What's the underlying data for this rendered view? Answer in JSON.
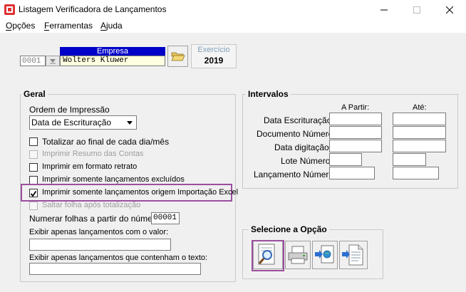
{
  "window": {
    "title": "Listagem Verificadora de Lançamentos"
  },
  "menu": [
    {
      "label": "Opções",
      "accel": "O"
    },
    {
      "label": "Ferramentas",
      "accel": "F"
    },
    {
      "label": "Ajuda",
      "accel": "A"
    }
  ],
  "empresa": {
    "label": "Empresa",
    "code": "0001",
    "name": "Wolters Kluwer"
  },
  "exercicio": {
    "label": "Exercício",
    "value": "2019"
  },
  "geral": {
    "title": "Geral",
    "ordem_label": "Ordem de Impressão",
    "ordem_value": "Data de Escrituração",
    "options": [
      {
        "label": "Totalizar ao final de cada dia/mês",
        "checked": false,
        "enabled": true
      },
      {
        "label": "Imprimir Resumo das Contas",
        "checked": false,
        "enabled": false
      },
      {
        "label": "Imprimir em formato retrato",
        "checked": false,
        "enabled": true
      },
      {
        "label": "Imprimir somente lançamentos excluídos",
        "checked": false,
        "enabled": true
      },
      {
        "label": "Imprimir somente lançamentos origem Importação Excel",
        "checked": true,
        "enabled": true
      },
      {
        "label": "Saltar folha após totalização",
        "checked": false,
        "enabled": false
      }
    ],
    "numerar_label": "Numerar folhas a partir do número",
    "numerar_value": "00001",
    "valor_label": "Exibir apenas lançamentos com o valor:",
    "valor_value": "",
    "texto_label": "Exibir apenas lançamentos que contenham o texto:",
    "texto_value": ""
  },
  "intervalos": {
    "title": "Intervalos",
    "col_from": "A Partir:",
    "col_to": "Até:",
    "rows": [
      {
        "label": "Data Escrituração",
        "from": "",
        "to": ""
      },
      {
        "label": "Documento Número",
        "from": "",
        "to": ""
      },
      {
        "label": "Data digitação",
        "from": "",
        "to": ""
      },
      {
        "label": "Lote Número",
        "from": "",
        "to": ""
      },
      {
        "label": "Lançamento Número",
        "from": "",
        "to": ""
      }
    ]
  },
  "selecione": {
    "title": "Selecione a Opção",
    "buttons": [
      "preview-icon",
      "printer-icon",
      "export-web-icon",
      "export-document-icon"
    ]
  },
  "colors": {
    "highlight": "#9b4f9f",
    "empresa_header": "#0000c8",
    "name_field": "#ffffe1"
  }
}
